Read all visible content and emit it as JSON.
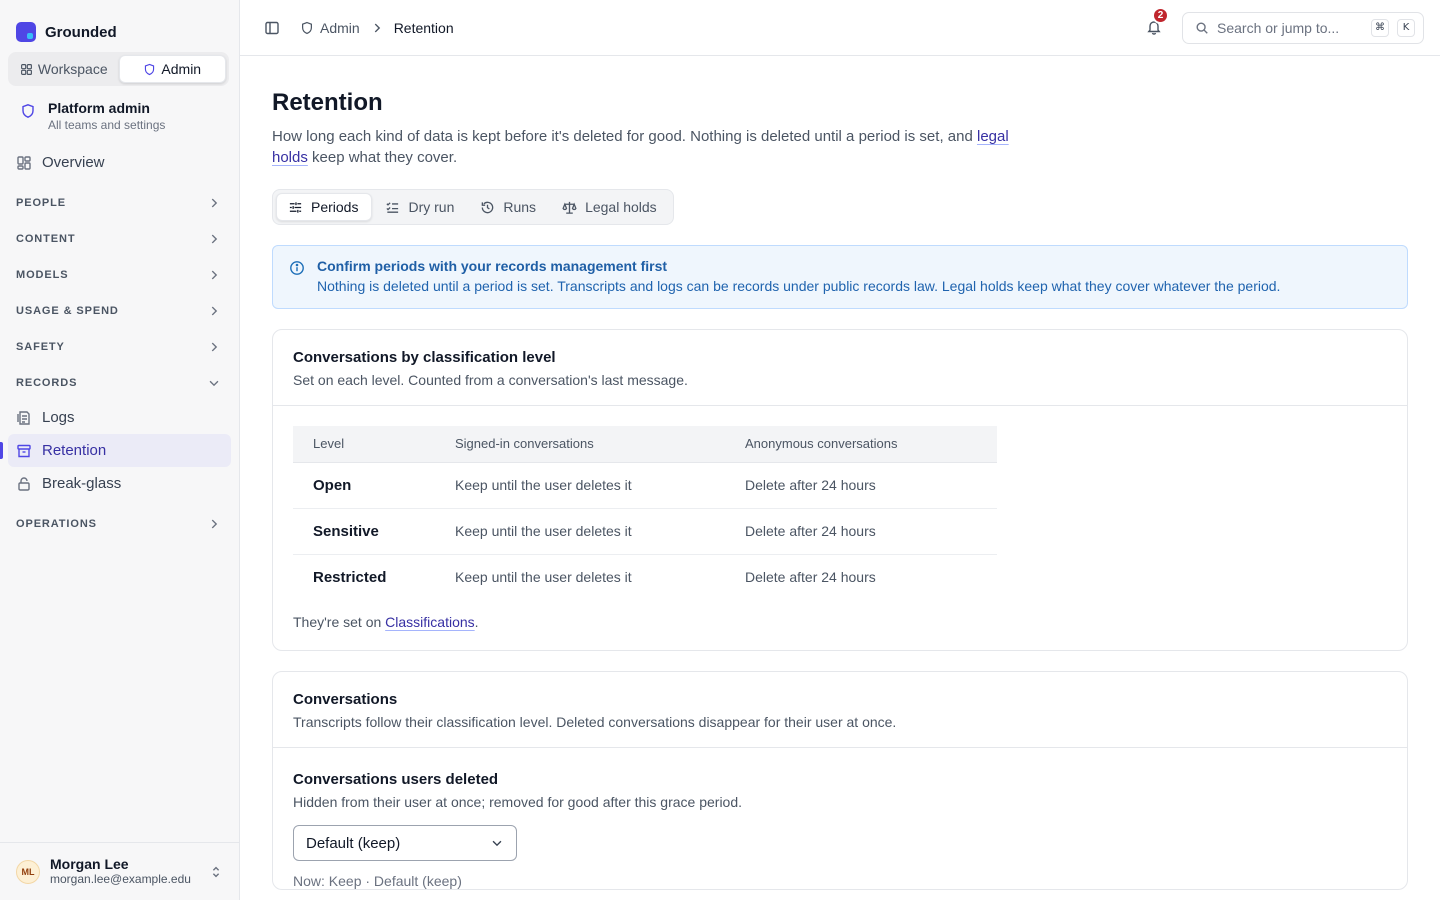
{
  "app": {
    "name": "Grounded"
  },
  "mode_switch": {
    "workspace": "Workspace",
    "admin": "Admin"
  },
  "scope": {
    "title": "Platform admin",
    "subtitle": "All teams and settings"
  },
  "nav": {
    "overview": "Overview",
    "sections": {
      "people": "PEOPLE",
      "content": "CONTENT",
      "models": "MODELS",
      "usage": "USAGE & SPEND",
      "safety": "SAFETY",
      "records": "RECORDS",
      "operations": "OPERATIONS"
    },
    "records_items": {
      "logs": "Logs",
      "retention": "Retention",
      "breakglass": "Break-glass"
    }
  },
  "user": {
    "initials": "ML",
    "name": "Morgan Lee",
    "email": "morgan.lee@example.edu"
  },
  "topbar": {
    "breadcrumb_parent": "Admin",
    "breadcrumb_current": "Retention",
    "notifications_count": "2",
    "search_placeholder": "Search or jump to...",
    "shortcut_mod": "⌘",
    "shortcut_key": "K"
  },
  "page": {
    "title": "Retention",
    "desc_before": "How long each kind of data is kept before it's deleted for good. Nothing is deleted until a period is set, and ",
    "desc_link": "legal holds",
    "desc_after": " keep what they cover."
  },
  "tabs": {
    "periods": "Periods",
    "dry_run": "Dry run",
    "runs": "Runs",
    "legal_holds": "Legal holds"
  },
  "alert": {
    "title": "Confirm periods with your records management first",
    "body": "Nothing is deleted until a period is set. Transcripts and logs can be records under public records law. Legal holds keep what they cover whatever the period."
  },
  "classification_card": {
    "title": "Conversations by classification level",
    "subtitle": "Set on each level. Counted from a conversation's last message.",
    "columns": {
      "level": "Level",
      "signed_in": "Signed-in conversations",
      "anonymous": "Anonymous conversations"
    },
    "rows": [
      {
        "level": "Open",
        "signed_in": "Keep until the user deletes it",
        "anonymous": "Delete after 24 hours"
      },
      {
        "level": "Sensitive",
        "signed_in": "Keep until the user deletes it",
        "anonymous": "Delete after 24 hours"
      },
      {
        "level": "Restricted",
        "signed_in": "Keep until the user deletes it",
        "anonymous": "Delete after 24 hours"
      }
    ],
    "footer_before": "They're set on ",
    "footer_link": "Classifications",
    "footer_after": "."
  },
  "conversations_card": {
    "title": "Conversations",
    "subtitle": "Transcripts follow their classification level. Deleted conversations disappear for their user at once.",
    "deleted_title": "Conversations users deleted",
    "deleted_subtitle": "Hidden from their user at once; removed for good after this grace period.",
    "select_value": "Default (keep)",
    "now_text": "Now: Keep · Default (keep)"
  }
}
